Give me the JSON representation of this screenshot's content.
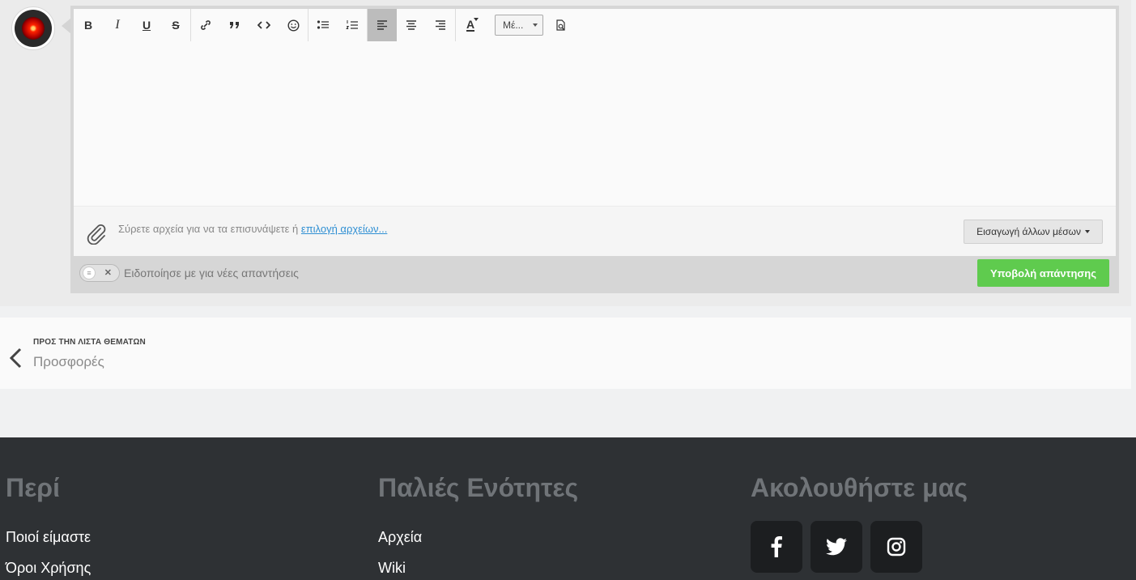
{
  "editor": {
    "toolbar": {
      "bold": "B",
      "italic": "I",
      "underline": "U",
      "strike": "S",
      "font_size_value": "Μέ...",
      "font_color_label": "A"
    },
    "attach_text": "Σύρετε αρχεία για να τα επισυνάψετε ή ",
    "attach_link": "επιλογή αρχείων...",
    "more_media": "Εισαγωγή άλλων μέσων",
    "notify_label": "Ειδοποίησε με για νέες απαντήσεις",
    "submit": "Υποβολή απάντησης"
  },
  "back_nav": {
    "kicker": "ΠΡΟΣ ΤΗΝ ΛΙΣΤΑ ΘΕΜΑΤΩΝ",
    "title": "Προσφορές"
  },
  "footer": {
    "col1": {
      "heading": "Περί",
      "links": [
        "Ποιοί είμαστε",
        "Όροι Χρήσης"
      ]
    },
    "col2": {
      "heading": "Παλιές Ενότητες",
      "links": [
        "Αρχεία",
        "Wiki"
      ]
    },
    "col3": {
      "heading": "Ακολουθήστε μας",
      "socials": [
        "facebook-icon",
        "twitter-icon",
        "instagram-icon"
      ]
    }
  },
  "colors": {
    "submit": "#5fcb4e",
    "link": "#2f8fd3",
    "footer_bg": "#2e3134"
  }
}
